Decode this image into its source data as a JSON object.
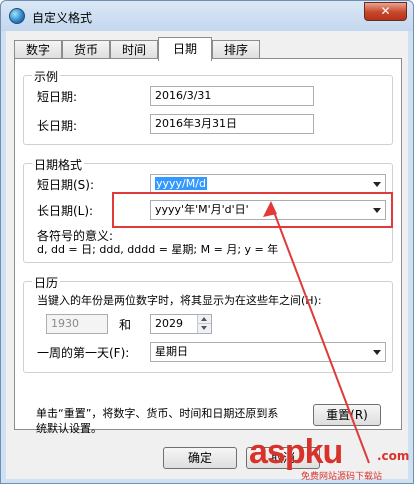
{
  "window": {
    "title": "自定义格式",
    "close_glyph": "✕"
  },
  "tabs": [
    {
      "label": "数字"
    },
    {
      "label": "货币"
    },
    {
      "label": "时间"
    },
    {
      "label": "日期"
    },
    {
      "label": "排序"
    }
  ],
  "sample": {
    "legend": "示例",
    "short_label": "短日期:",
    "short_value": "2016/3/31",
    "long_label": "长日期:",
    "long_value": "2016年3月31日"
  },
  "date_format": {
    "legend": "日期格式",
    "short_label": "短日期(S):",
    "short_value": "yyyy/M/d",
    "long_label": "长日期(L):",
    "long_value": "yyyy'年'M'月'd'日'",
    "symbols_title": "各符号的意义:",
    "symbols_desc": "d, dd = 日;  ddd, dddd = 星期;  M = 月;  y = 年"
  },
  "calendar": {
    "legend": "日历",
    "two_digit_text": "当键入的年份是两位数字时，将其显示为在这些年之间(H):",
    "year_from": "1930",
    "and_label": "和",
    "year_to": "2029",
    "first_day_label": "一周的第一天(F):",
    "first_day_value": "星期日"
  },
  "reset": {
    "text_line1": "单击“重置”，将数字、货币、时间和日期还原到系",
    "text_line2": "统默认设置。",
    "button_label": "重置(R)"
  },
  "footer": {
    "ok_label": "确定",
    "cancel_label": "取消"
  },
  "watermark": {
    "brand": "aspku",
    "brand_suffix": ".com",
    "tagline": "免费网站源码下载站"
  },
  "colors": {
    "annotation_red": "#e03a3a",
    "selection_blue": "#3399ff"
  }
}
